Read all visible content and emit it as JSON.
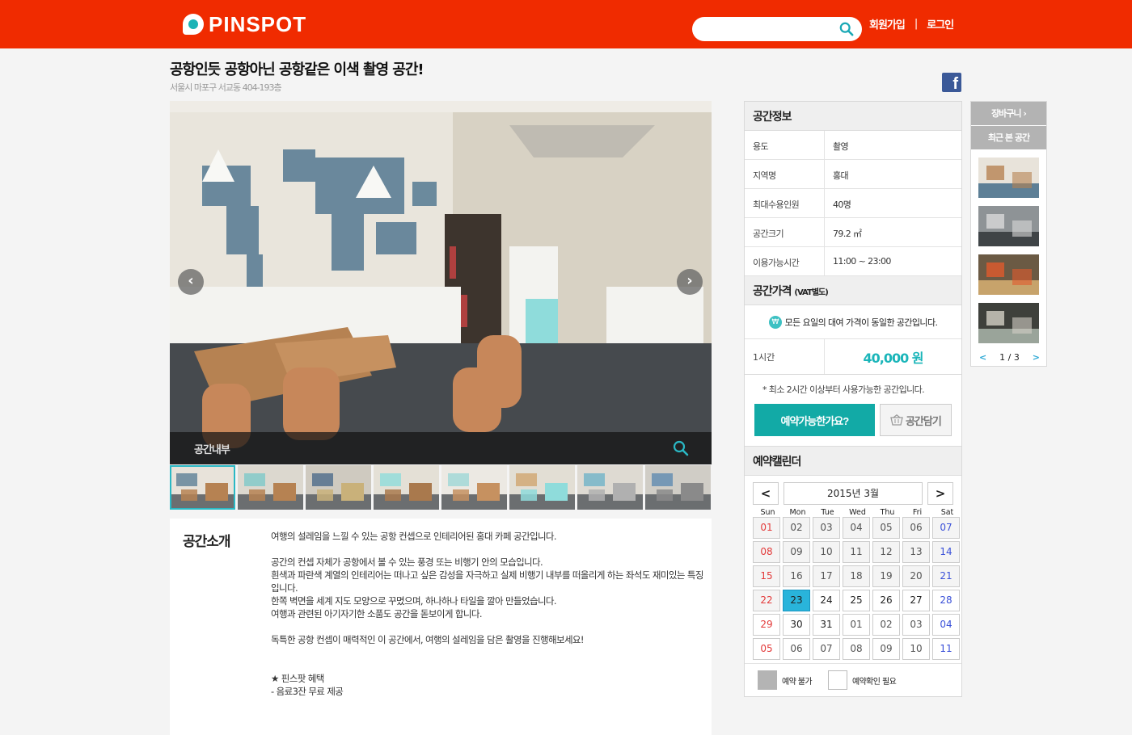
{
  "header": {
    "logo": "PINSPOT",
    "search_placeholder": "",
    "signup": "회원가입",
    "separator": "|",
    "login": "로그인"
  },
  "listing": {
    "title": "공항인듯 공항아닌 공항같은 이색 촬영 공간!",
    "address": "서울시 마포구 서교동 404-193층"
  },
  "gallery": {
    "caption": "공간내부",
    "prev_icon": "chevron-left-icon",
    "next_icon": "chevron-right-icon",
    "thumbnail_count": 8,
    "active_thumbnail": 1
  },
  "intro": {
    "heading": "공간소개",
    "paragraphs": [
      "여행의 설레임을 느낄 수 있는 공항 컨셉으로 인테리어된 홍대 카페 공간입니다.",
      "",
      "공간의 컨셉 자체가 공항에서 볼 수 있는 풍경 또는 비행기 안의 모습입니다.",
      "흰색과 파란색 계열의 인테리어는 떠나고 싶은 감성을 자극하고 실제 비행기 내부를 떠올리게 하는 좌석도 재미있는 특징입니다.",
      "한쪽 벽면을 세계 지도 모양으로 꾸몄으며, 하나하나 타일을 깔아 만들었습니다.",
      "여행과 관련된 아기자기한 소품도 공간을 돋보이게 합니다.",
      "",
      "독특한 공항 컨셉이 매력적인 이 공간에서, 여행의 설레임을 담은 촬영을 진행해보세요!",
      "",
      "",
      "★ 핀스팟 혜택",
      "- 음료3잔 무료 제공"
    ]
  },
  "info": {
    "heading": "공간정보",
    "rows": [
      {
        "label": "용도",
        "value": "촬영"
      },
      {
        "label": "지역명",
        "value": "홍대"
      },
      {
        "label": "최대수용인원",
        "value": "40명"
      },
      {
        "label": "공간크기",
        "value": "79.2 ㎡"
      },
      {
        "label": "이용가능시간",
        "value": "11:00 ~ 23:00"
      }
    ]
  },
  "pricing": {
    "heading": "공간가격",
    "heading_note": "(VAT별도)",
    "notice_icon": "₩",
    "notice": "모든 요일의 대여 가격이 동일한 공간입니다.",
    "unit": "1시간",
    "price": "40,000 원",
    "min_note": "* 최소 2시간 이상부터 사용가능한 공간입니다.",
    "reserve_button": "예약가능한가요?",
    "cart_button": "공간담기"
  },
  "calendar": {
    "heading": "예약캘린더",
    "prev": "<",
    "next": ">",
    "month": "2015년 3월",
    "weekdays": [
      "Sun",
      "Mon",
      "Tue",
      "Wed",
      "Thu",
      "Fri",
      "Sat"
    ],
    "days": [
      "01",
      "02",
      "03",
      "04",
      "05",
      "06",
      "07",
      "08",
      "09",
      "10",
      "11",
      "12",
      "13",
      "14",
      "15",
      "16",
      "17",
      "18",
      "19",
      "20",
      "21",
      "22",
      "23",
      "24",
      "25",
      "26",
      "27",
      "28",
      "29",
      "30",
      "31",
      "01",
      "02",
      "03",
      "04",
      "05",
      "06",
      "07",
      "08",
      "09",
      "10",
      "11"
    ],
    "today": "23",
    "legend": [
      {
        "label": "예약 불가",
        "swatch": "#b4b4b4"
      },
      {
        "label": "예약확인 필요",
        "swatch": "#ffffff"
      }
    ]
  },
  "rail": {
    "cart": "장바구니",
    "cart_icon": "chevron-right-icon",
    "recent": "최근 본 공간",
    "prev": "<",
    "page": "1 / 3",
    "next": ">"
  },
  "colors": {
    "brand": "#f02b00",
    "accent": "#12aaa6",
    "price": "#1ab5b9",
    "today": "#29b4db"
  }
}
